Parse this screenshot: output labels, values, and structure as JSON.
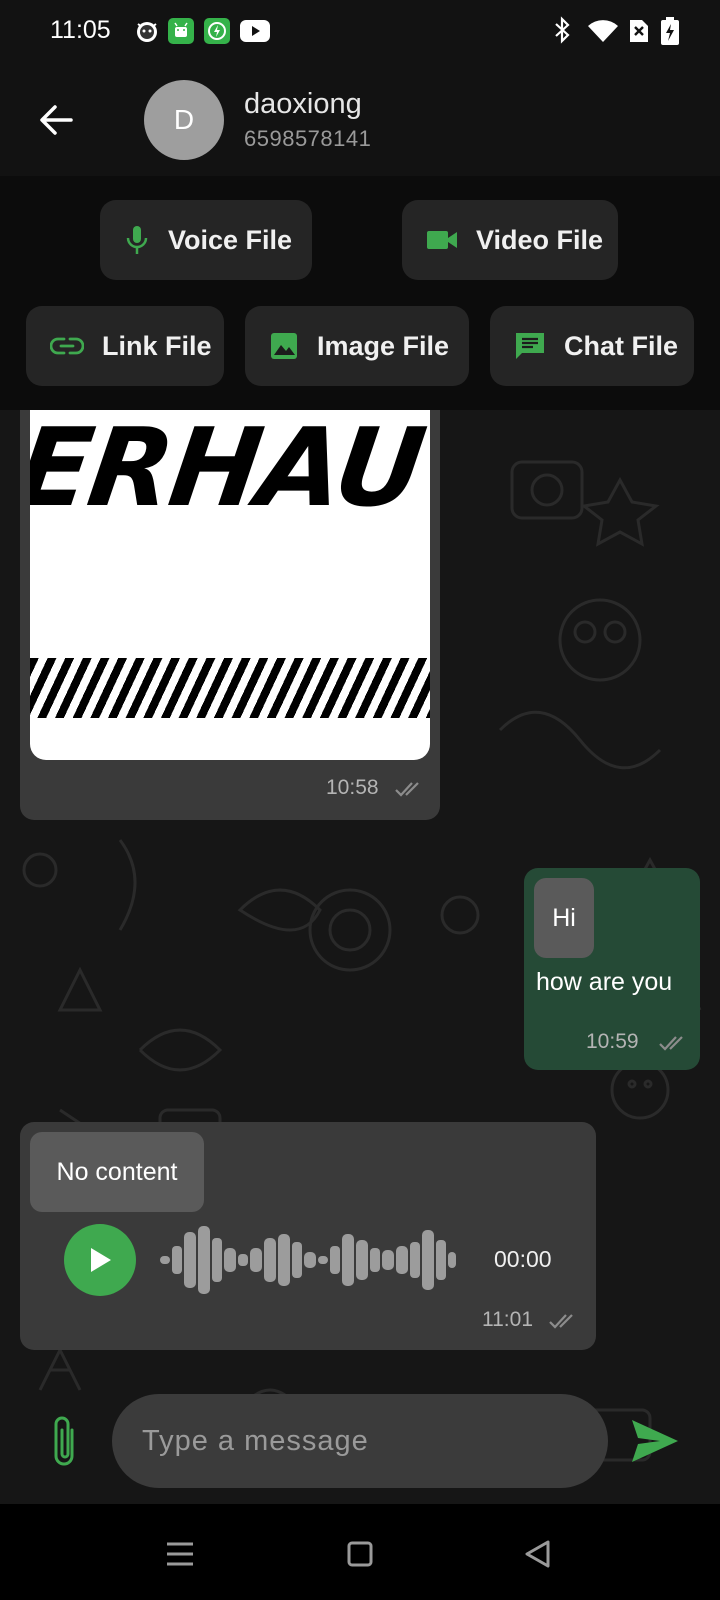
{
  "status_bar": {
    "time": "11:05",
    "left_icons": [
      "cat-app-icon",
      "android-app-icon",
      "shield-app-icon",
      "youtube-icon"
    ],
    "right_icons": [
      "bluetooth-icon",
      "wifi-icon",
      "sim-off-icon",
      "battery-charging-icon"
    ]
  },
  "header": {
    "avatar_initial": "D",
    "name": "daoxiong",
    "phone": "6598578141"
  },
  "file_buttons": {
    "voice": "Voice File",
    "video": "Video File",
    "link": "Link File",
    "image": "Image File",
    "chat": "Chat File"
  },
  "messages": {
    "image": {
      "image_text": "ERHAU",
      "time": "10:58"
    },
    "text": {
      "chip": "Hi",
      "line": "how are you",
      "time": "10:59"
    },
    "audio": {
      "chip": "No content",
      "duration": "00:00",
      "time": "11:01"
    }
  },
  "composer": {
    "placeholder": "Type a message"
  },
  "colors": {
    "accent_green": "#3fa94f",
    "outgoing_bubble": "#254a36",
    "incoming_bubble": "#3a3a3a",
    "background": "#121212"
  }
}
